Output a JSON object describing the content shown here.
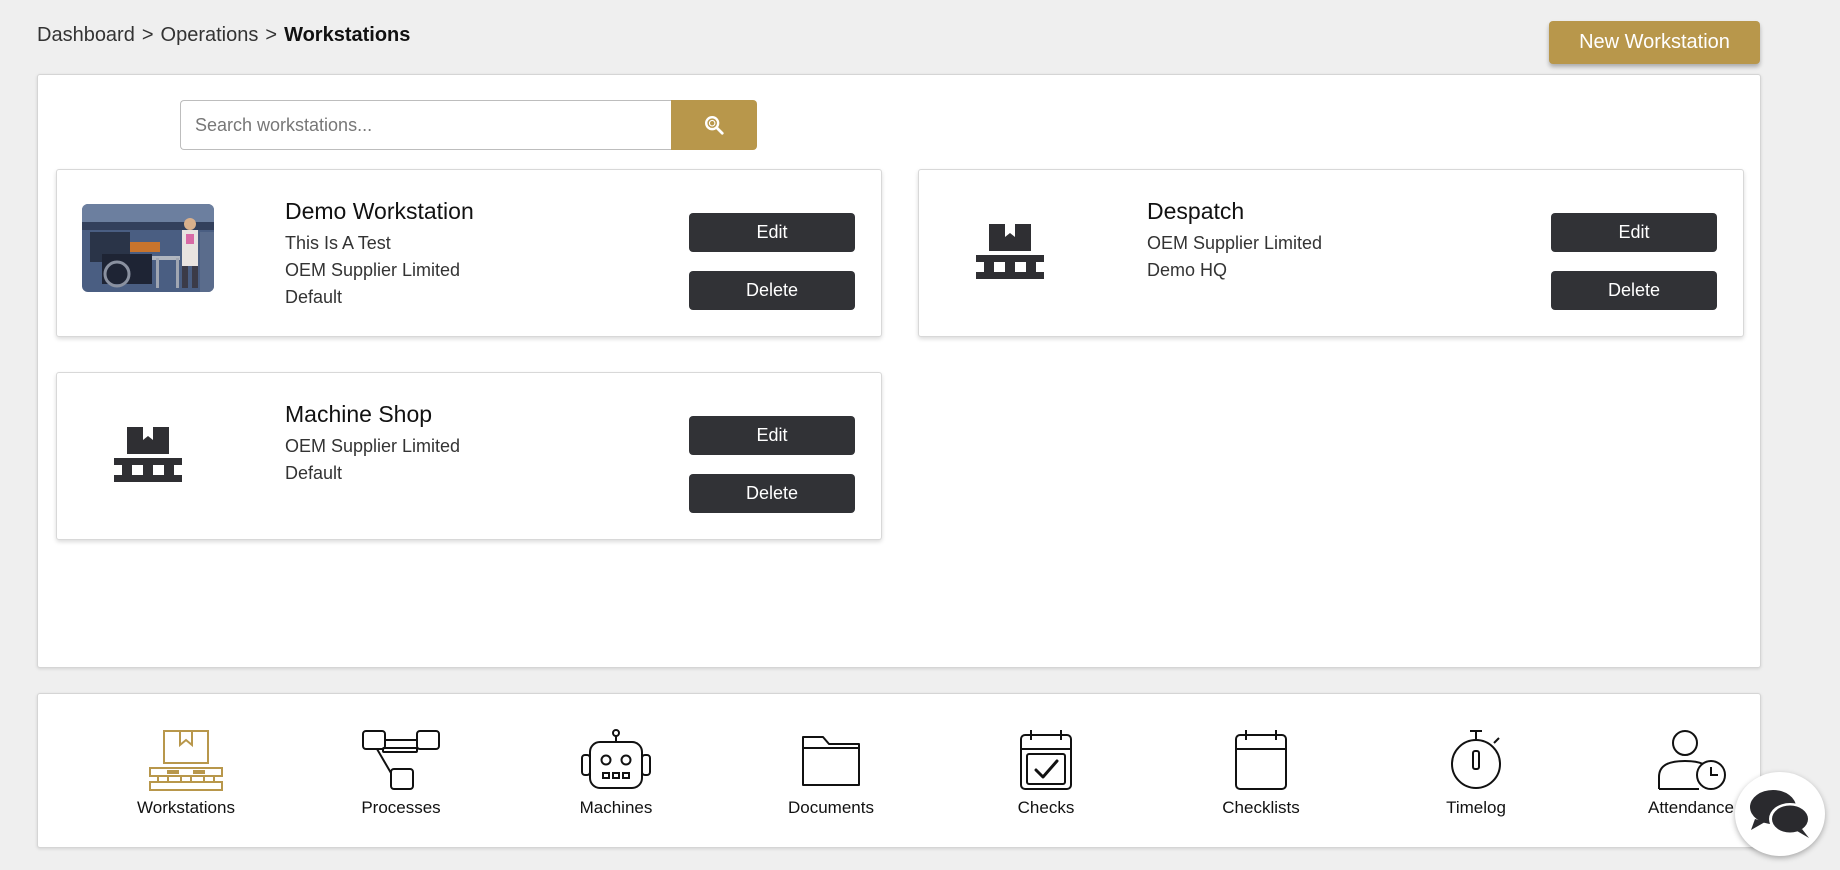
{
  "breadcrumb": {
    "items": [
      "Dashboard",
      "Operations"
    ],
    "current": "Workstations",
    "separator": ">"
  },
  "header": {
    "new_button_label": "New Workstation"
  },
  "search": {
    "placeholder": "Search workstations...",
    "value": ""
  },
  "workstations": [
    {
      "title": "Demo Workstation",
      "lines": [
        "This Is A Test",
        "OEM Supplier Limited",
        "Default"
      ],
      "has_image": true
    },
    {
      "title": "Despatch",
      "lines": [
        "OEM Supplier Limited",
        "Demo HQ"
      ],
      "has_image": false
    },
    {
      "title": "Machine Shop",
      "lines": [
        "OEM Supplier Limited",
        "Default"
      ],
      "has_image": false
    }
  ],
  "card_actions": {
    "edit_label": "Edit",
    "delete_label": "Delete"
  },
  "bottom_nav": [
    {
      "label": "Workstations",
      "icon": "workstation-icon",
      "active": true
    },
    {
      "label": "Processes",
      "icon": "processes-icon",
      "active": false
    },
    {
      "label": "Machines",
      "icon": "robot-icon",
      "active": false
    },
    {
      "label": "Documents",
      "icon": "folder-icon",
      "active": false
    },
    {
      "label": "Checks",
      "icon": "calendar-check-icon",
      "active": false
    },
    {
      "label": "Checklists",
      "icon": "calendar-icon",
      "active": false
    },
    {
      "label": "Timelog",
      "icon": "stopwatch-icon",
      "active": false
    },
    {
      "label": "Attendance",
      "icon": "user-clock-icon",
      "active": false
    }
  ],
  "colors": {
    "accent": "#b8974b",
    "dark_button": "#313236",
    "background": "#efefef"
  }
}
